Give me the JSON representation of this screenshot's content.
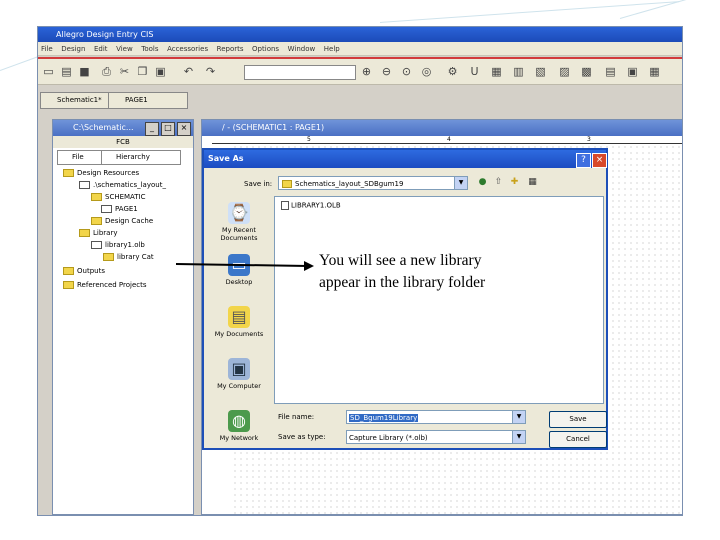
{
  "app": {
    "title": "Allegro Design Entry CIS",
    "menu": [
      "File",
      "Design",
      "Edit",
      "View",
      "Tools",
      "Accessories",
      "Reports",
      "Options",
      "Window",
      "Help"
    ],
    "tabs": [
      "Schematic1*",
      "PAGE1"
    ]
  },
  "project_manager": {
    "title": "C:\\Schematic...",
    "header": "FCB",
    "tabs": [
      "File",
      "Hierarchy"
    ],
    "tree": [
      {
        "label": "Design Resources",
        "type": "folder"
      },
      {
        "label": ".\\schematics_layout_",
        "type": "page"
      },
      {
        "label": "SCHEMATIC",
        "type": "folder"
      },
      {
        "label": "PAGE1",
        "type": "page"
      },
      {
        "label": "Design Cache",
        "type": "folder"
      },
      {
        "label": "Library",
        "type": "folder"
      },
      {
        "label": "library1.olb",
        "type": "page"
      },
      {
        "label": "library Cat",
        "type": "folder"
      },
      {
        "label": "Outputs",
        "type": "folder"
      },
      {
        "label": "Referenced Projects",
        "type": "folder"
      }
    ]
  },
  "schematic": {
    "title": "/ - (SCHEMATIC1 : PAGE1)",
    "ruler": [
      "5",
      "4",
      "3"
    ]
  },
  "save_as": {
    "title": "Save As",
    "save_in_label": "Save in:",
    "save_in_value": "Schematics_layout_SDBgum19",
    "places": [
      "My Recent Documents",
      "Desktop",
      "My Documents",
      "My Computer",
      "My Network"
    ],
    "files": [
      "LIBRARY1.OLB"
    ],
    "file_name_label": "File name:",
    "file_name_value": "SD_Bgum19Library",
    "file_type_label": "Save as type:",
    "file_type_value": "Capture Library (*.olb)",
    "save_button": "Save",
    "cancel_button": "Cancel"
  },
  "annotation": {
    "text": "You will see a new library appear in the library folder"
  }
}
